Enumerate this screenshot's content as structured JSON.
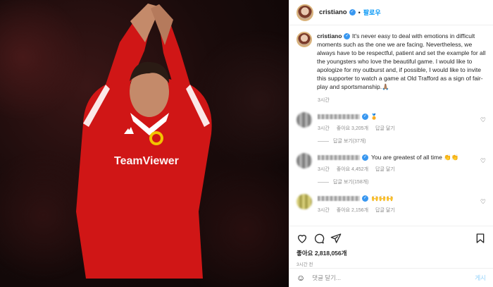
{
  "header": {
    "username": "cristiano",
    "follow_label": "팔로우"
  },
  "caption": {
    "username": "cristiano",
    "text": "It's never easy to deal with emotions in difficult moments such as the one we are facing. Nevertheless, we always have to be respectful, patient and set the example for all the youngsters who love the beautiful game. I would like to apologize for my outburst and, if possible, I would like to invite this supporter to watch a game at Old Trafford as a sign of fair-play and sportsmanship.🙏🏽",
    "time": "3시간"
  },
  "comments": [
    {
      "text": "",
      "time": "3시간",
      "likes": "좋아요 3,205개",
      "reply_label": "답글 달기",
      "view_replies": "답글 보기(37개)"
    },
    {
      "text": "You are greatest of all time 👏👏",
      "time": "3시간",
      "likes": "좋아요 4,452개",
      "reply_label": "답글 달기",
      "view_replies": "답글 보기(158개)"
    },
    {
      "text": "🙌🙌🙌",
      "time": "3시간",
      "likes": "좋아요 2,156개",
      "reply_label": "답글 달기"
    }
  ],
  "actions": {
    "likes_count": "좋아요 2,818,056개",
    "post_time": "3시간 전"
  },
  "add_comment": {
    "placeholder": "댓글 달기...",
    "post_label": "게시"
  },
  "colors": {
    "accent": "#0095f6",
    "jersey": "#d01616"
  }
}
